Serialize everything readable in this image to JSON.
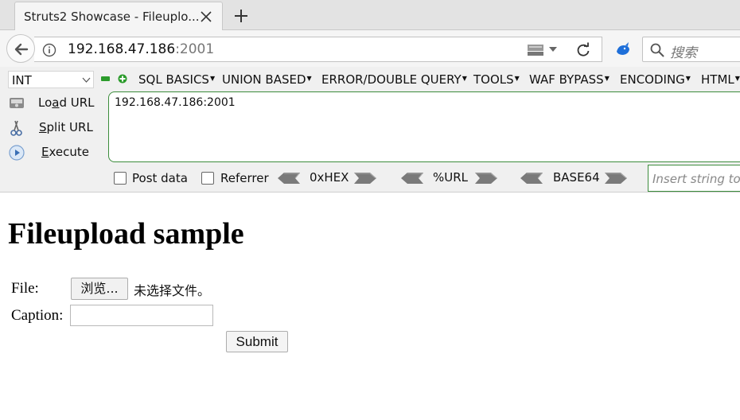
{
  "tab": {
    "title": "Struts2 Showcase - Fileuplo..."
  },
  "navbar": {
    "url_host": "192.168.47.186",
    "url_port": ":2001",
    "search_placeholder": "搜索"
  },
  "hackbar": {
    "type_select": "INT",
    "menus": [
      {
        "label": "SQL BASICS"
      },
      {
        "label": "UNION BASED"
      },
      {
        "label": "ERROR/DOUBLE QUERY"
      },
      {
        "label": "TOOLS"
      },
      {
        "label": "WAF BYPASS"
      },
      {
        "label": "ENCODING"
      },
      {
        "label": "HTML"
      }
    ],
    "actions": {
      "load_url_pre": "Lo",
      "load_url_u": "a",
      "load_url_post": "d URL",
      "split_url_u": "S",
      "split_url_post": "plit URL",
      "execute_u": "E",
      "execute_post": "xecute"
    },
    "url_value": "192.168.47.186:2001",
    "post_data_label": "Post data",
    "referrer_label": "Referrer",
    "hex_label": "0xHEX",
    "url_enc_label": "%URL",
    "base64_label": "BASE64",
    "insert_placeholder": "Insert string to"
  },
  "page": {
    "title": "Fileupload sample",
    "file_label": "File:",
    "browse_label": "浏览...",
    "no_file_text": "未选择文件。",
    "caption_label": "Caption:",
    "caption_value": "",
    "submit_label": "Submit"
  }
}
